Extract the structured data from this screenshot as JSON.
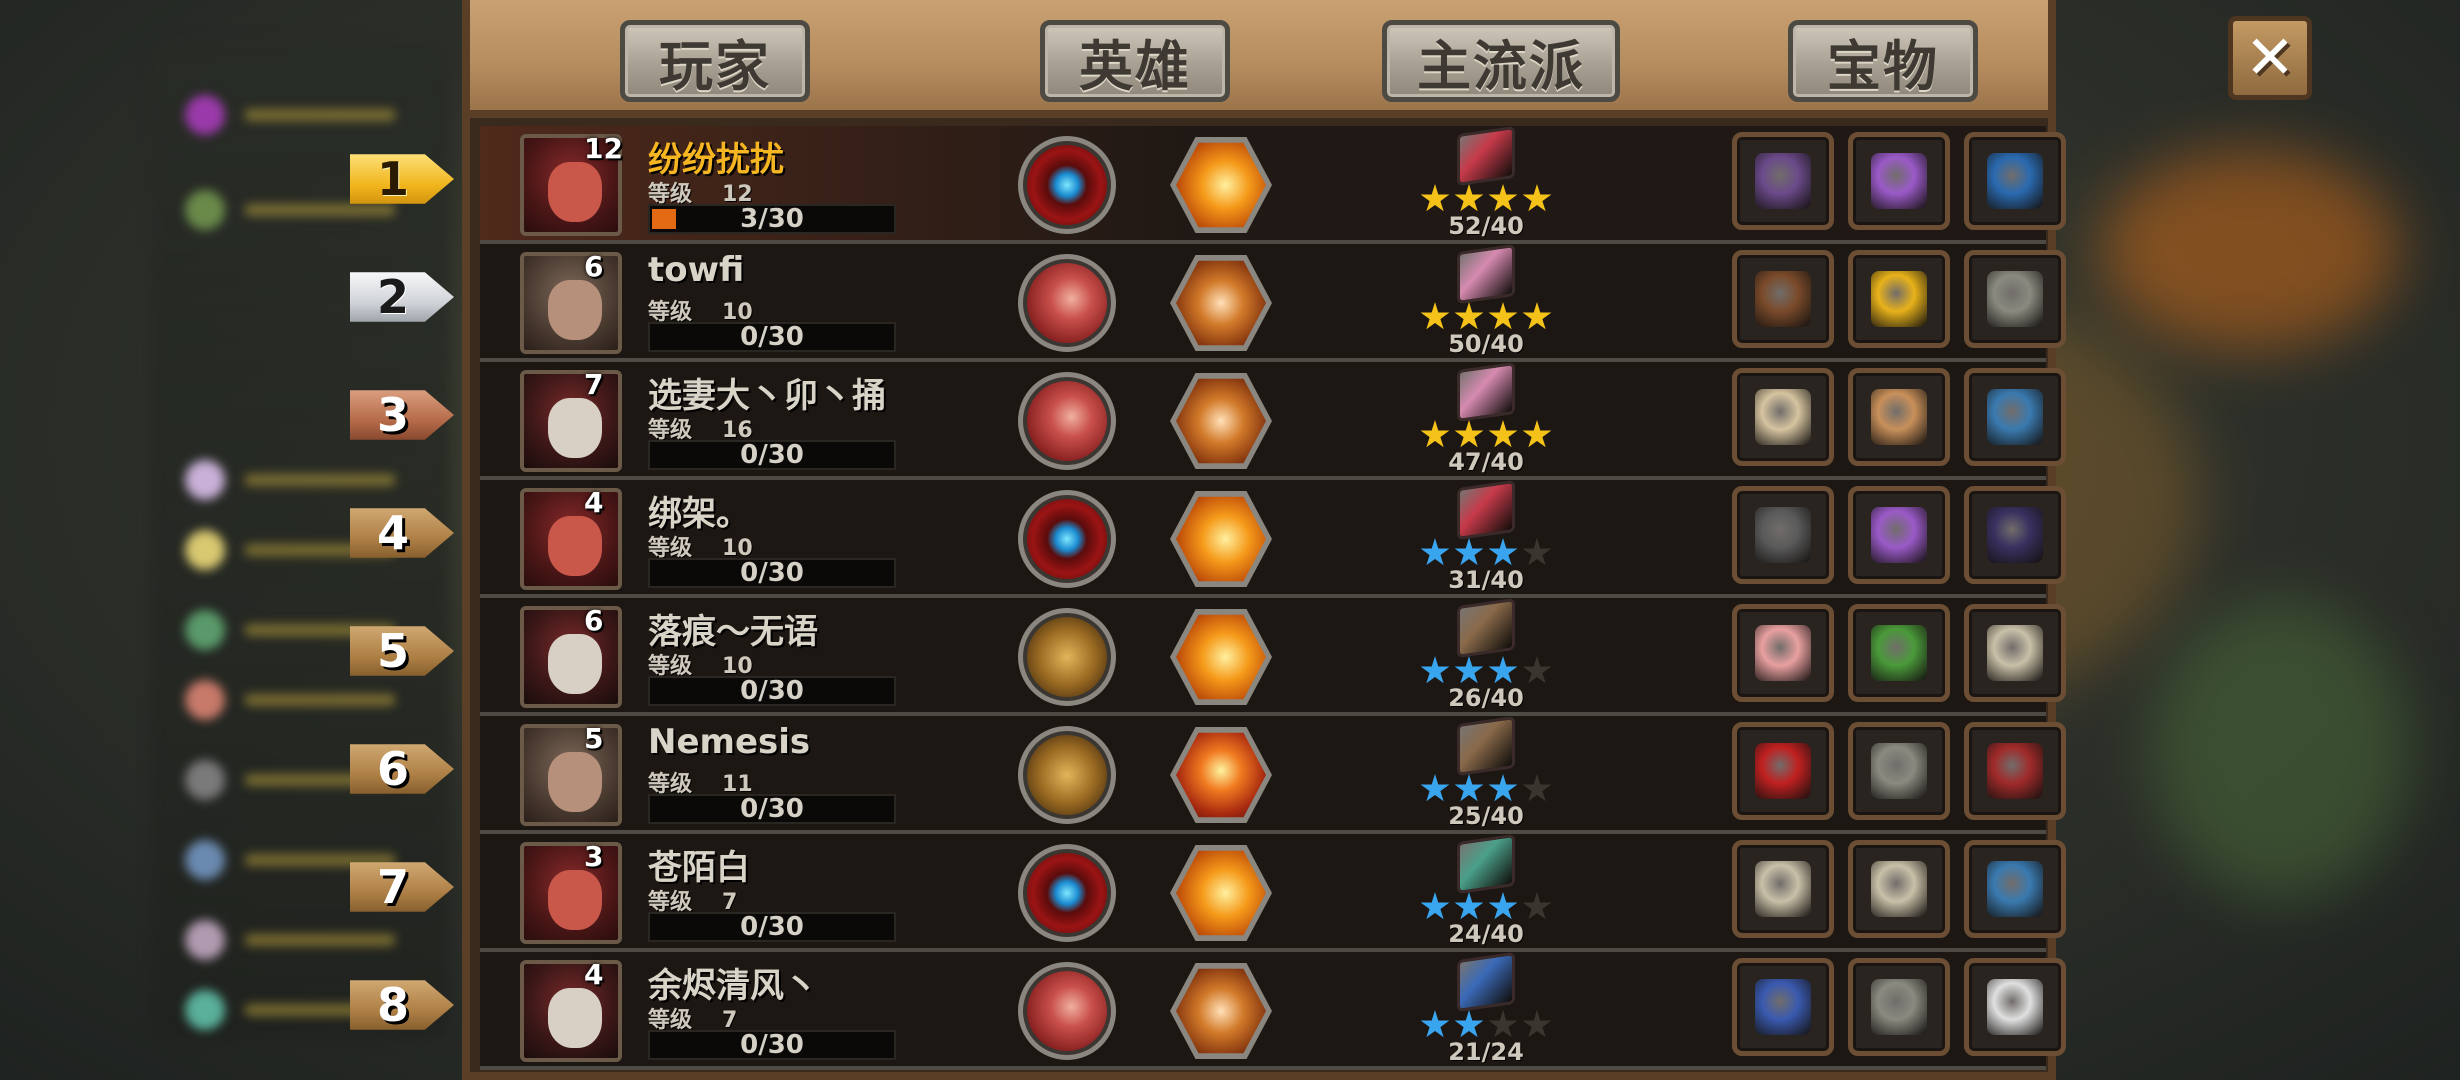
{
  "tabs": [
    "玩家",
    "英雄",
    "主流派",
    "宝物"
  ],
  "close_icon": "close-x-icon",
  "level_label": "等级",
  "rows": [
    {
      "rank": "1",
      "rank_style": "gold",
      "avatar": "red-demon",
      "badge": "12",
      "name": "纷纷扰扰",
      "level": "12",
      "xp": "3/30",
      "xp_fraction": 0.1,
      "skill": "blue-orb",
      "hero_skill": "fire",
      "book_color": "#c73a4a",
      "stars": {
        "filled": 4,
        "color": "gold"
      },
      "score": "52/40",
      "items": [
        "purple-staff",
        "potion",
        "treasure-chest"
      ]
    },
    {
      "rank": "2",
      "rank_style": "silver",
      "avatar": "ogre",
      "badge": "6",
      "name": "towfi",
      "level": "10",
      "xp": "0/30",
      "xp_fraction": 0,
      "skill": "red-swirl",
      "hero_skill": "chomper",
      "book_color": "#d68ab0",
      "stars": {
        "filled": 4,
        "color": "gold"
      },
      "score": "50/40",
      "items": [
        "leather-armor",
        "gold-coin",
        "scroll"
      ]
    },
    {
      "rank": "3",
      "rank_style": "bronze",
      "avatar": "hooded",
      "badge": "7",
      "name": "选妻大丶卯丶捅",
      "level": "16",
      "xp": "0/30",
      "xp_fraction": 0,
      "skill": "red-swirl",
      "hero_skill": "chomper",
      "book_color": "#d68ab0",
      "stars": {
        "filled": 4,
        "color": "gold"
      },
      "score": "47/40",
      "items": [
        "horn",
        "ring",
        "lantern"
      ]
    },
    {
      "rank": "4",
      "rank_style": "wood",
      "avatar": "red-demon",
      "badge": "4",
      "name": "绑架。",
      "level": "10",
      "xp": "0/30",
      "xp_fraction": 0,
      "skill": "blue-orb",
      "hero_skill": "fire",
      "book_color": "#c73a4a",
      "stars": {
        "filled": 3,
        "color": "blue"
      },
      "score": "31/40",
      "items": [
        "tablet",
        "potion",
        "dark-rod"
      ]
    },
    {
      "rank": "5",
      "rank_style": "wood",
      "avatar": "hooded",
      "badge": "6",
      "name": "落痕～无语",
      "level": "10",
      "xp": "0/30",
      "xp_fraction": 0,
      "skill": "bronze-cross",
      "hero_skill": "fire",
      "book_color": "#8a6a4a",
      "stars": {
        "filled": 3,
        "color": "blue"
      },
      "score": "26/40",
      "items": [
        "piggy-bank",
        "cash-stack",
        "medallion"
      ]
    },
    {
      "rank": "6",
      "rank_style": "wood",
      "avatar": "knight",
      "badge": "5",
      "name": "Nemesis",
      "level": "11",
      "xp": "0/30",
      "xp_fraction": 0,
      "skill": "bronze-cross",
      "hero_skill": "burst",
      "book_color": "#8a6a4a",
      "stars": {
        "filled": 3,
        "color": "blue"
      },
      "score": "25/40",
      "items": [
        "red-axe",
        "spear",
        "red-rocket"
      ]
    },
    {
      "rank": "7",
      "rank_style": "wood",
      "avatar": "red-demon",
      "badge": "3",
      "name": "苍陌白",
      "level": "7",
      "xp": "0/30",
      "xp_fraction": 0,
      "skill": "blue-orb",
      "hero_skill": "fire",
      "book_color": "#4aa08a",
      "stars": {
        "filled": 3,
        "color": "blue"
      },
      "score": "24/40",
      "items": [
        "medallion",
        "medallion",
        "lantern"
      ]
    },
    {
      "rank": "8",
      "rank_style": "wood",
      "avatar": "hooded",
      "badge": "4",
      "name": "余烬清风丶",
      "level": "7",
      "xp": "0/30",
      "xp_fraction": 0,
      "skill": "red-swirl",
      "hero_skill": "chomper",
      "book_color": "#3a6ab8",
      "stars": {
        "filled": 2,
        "color": "blue"
      },
      "score": "21/24",
      "items": [
        "gem-crown",
        "spear",
        "first-aid-kit"
      ]
    }
  ],
  "item_colors": {
    "purple-staff": "#6b4a8a",
    "potion": "#9a5ac8",
    "treasure-chest": "#2a6ab0",
    "leather-armor": "#7a4a2a",
    "gold-coin": "#e8b21a",
    "scroll": "#8a8a80",
    "horn": "#d6c4a0",
    "ring": "#c8905a",
    "lantern": "#3a7ab0",
    "tablet": "#5a5a5a",
    "dark-rod": "#3a3060",
    "piggy-bank": "#e8a0a0",
    "cash-stack": "#4a9a3a",
    "medallion": "#c9c0a8",
    "red-axe": "#c02020",
    "spear": "#8a8a80",
    "red-rocket": "#a02a2a",
    "gem-crown": "#3a5ab0",
    "first-aid-kit": "#e0e0e0"
  }
}
